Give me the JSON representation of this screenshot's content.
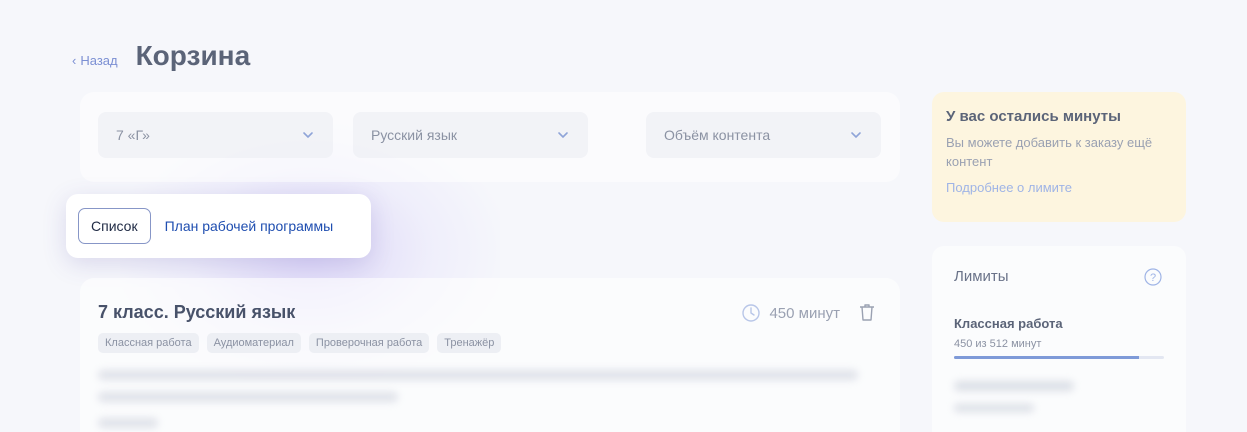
{
  "header": {
    "back_label": "Назад",
    "title": "Корзина"
  },
  "filters": [
    {
      "value": "7 «Г»"
    },
    {
      "value": "Русский язык"
    },
    {
      "value": "Объём контента"
    }
  ],
  "view_tabs": {
    "active": "Список",
    "other": "План рабочей программы"
  },
  "course": {
    "title": "7 класс. Русский язык",
    "minutes": "450 минут",
    "tags": [
      "Классная работа",
      "Аудиоматериал",
      "Проверочная работа",
      "Тренажёр"
    ]
  },
  "notice": {
    "title": "У вас остались минуты",
    "text": "Вы можете добавить к заказу ещё контент",
    "link": "Подробнее о лимите"
  },
  "limits": {
    "title": "Лимиты",
    "items": [
      {
        "name": "Классная работа",
        "usage": "450 из 512 минут",
        "progress": 0.879
      }
    ]
  },
  "colors": {
    "accent": "#1f4eb0",
    "notice_bg": "#fdf5df",
    "progress": "#7e9ad8"
  }
}
